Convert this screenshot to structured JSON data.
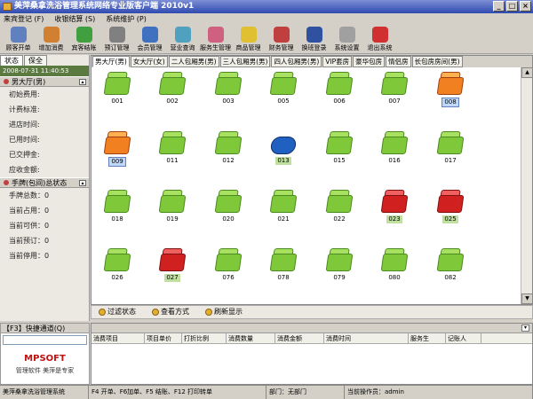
{
  "app": {
    "title": "美萍桑拿洗浴管理系统网络专业版客户端 2010v1"
  },
  "menu": [
    "来宾登记 (F)",
    "收银结算 (S)",
    "系统维护 (P)"
  ],
  "toolbar": [
    {
      "label": "顾客开单",
      "color": "#6080c0"
    },
    {
      "label": "增加消费",
      "color": "#d08030"
    },
    {
      "label": "宾客结账",
      "color": "#40a040"
    },
    {
      "label": "预订管理",
      "color": "#808080"
    },
    {
      "label": "会员管理",
      "color": "#4070c0"
    },
    {
      "label": "营业查询",
      "color": "#50a0c0"
    },
    {
      "label": "服务生管理",
      "color": "#d06080"
    },
    {
      "label": "商品管理",
      "color": "#e0c030"
    },
    {
      "label": "财务管理",
      "color": "#c04040"
    },
    {
      "label": "换班登录",
      "color": "#3050a0"
    },
    {
      "label": "系统设置",
      "color": "#a0a0a0"
    },
    {
      "label": "退出系统",
      "color": "#d03030"
    }
  ],
  "left": {
    "tabs": [
      "状态",
      "保全"
    ],
    "datetime": "2008-07-31 11:40:53",
    "room_header": "男大厅(男)",
    "fields": [
      "初始费用:",
      "计费标准:",
      "进店时间:",
      "已用时间:",
      "已交押金:",
      "应收金额:"
    ],
    "hand_header": "手牌(包间)总状态",
    "stats": [
      "手牌总数：0",
      "当前占用：0",
      "当前可供：0",
      "当前预订：0",
      "当前停用：0"
    ]
  },
  "room_tabs": [
    "男大厅(男)",
    "女大厅(女)",
    "二人包厢男(男)",
    "三人包厢男(男)",
    "四人包厢男(男)",
    "VIP套房",
    "豪华包房",
    "情侣房",
    "长包房房间(男)"
  ],
  "rooms": [
    {
      "num": "001",
      "state": "green"
    },
    {
      "num": "002",
      "state": "green"
    },
    {
      "num": "003",
      "state": "green"
    },
    {
      "num": "005",
      "state": "green"
    },
    {
      "num": "006",
      "state": "green"
    },
    {
      "num": "007",
      "state": "green"
    },
    {
      "num": "008",
      "state": "orange"
    },
    {
      "num": "009",
      "state": "orange"
    },
    {
      "num": "011",
      "state": "green"
    },
    {
      "num": "012",
      "state": "green"
    },
    {
      "num": "013",
      "state": "blue"
    },
    {
      "num": "015",
      "state": "green"
    },
    {
      "num": "016",
      "state": "green"
    },
    {
      "num": "017",
      "state": "green"
    },
    {
      "num": "018",
      "state": "green"
    },
    {
      "num": "019",
      "state": "green"
    },
    {
      "num": "020",
      "state": "green"
    },
    {
      "num": "021",
      "state": "green"
    },
    {
      "num": "022",
      "state": "green"
    },
    {
      "num": "023",
      "state": "red"
    },
    {
      "num": "025",
      "state": "red"
    },
    {
      "num": "026",
      "state": "green"
    },
    {
      "num": "027",
      "state": "red"
    },
    {
      "num": "076",
      "state": "green"
    },
    {
      "num": "078",
      "state": "green"
    },
    {
      "num": "079",
      "state": "green"
    },
    {
      "num": "080",
      "state": "green"
    },
    {
      "num": "082",
      "state": "green"
    }
  ],
  "filterbar": [
    "过滤状态",
    "查看方式",
    "刷新显示"
  ],
  "quick": {
    "header": "【F3】快捷通道(Q)",
    "logo": "MPSOFT",
    "slogan": "管理软件  美萍是专家"
  },
  "consume_cols": [
    "消费项目",
    "项目单价",
    "打折比例",
    "消费数量",
    "消费金额",
    "消费时间",
    "服务生",
    "记账人"
  ],
  "status": [
    "美萍桑拿洗浴管理系统",
    "F4 开单、F6加单、F5 结账、F12 打印转单",
    "部门：无部门",
    "当前操作员：admin"
  ]
}
